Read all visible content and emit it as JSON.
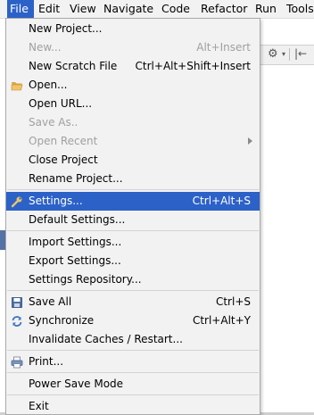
{
  "menubar": {
    "items": [
      {
        "label": "File"
      },
      {
        "label": "Edit"
      },
      {
        "label": "View"
      },
      {
        "label": "Navigate"
      },
      {
        "label": "Code"
      },
      {
        "label": "Refactor"
      },
      {
        "label": "Run"
      },
      {
        "label": "Tools"
      }
    ]
  },
  "file_menu": {
    "items": [
      {
        "label": "New Project...",
        "shortcut": ""
      },
      {
        "label": "New...",
        "shortcut": "Alt+Insert"
      },
      {
        "label": "New Scratch File",
        "shortcut": "Ctrl+Alt+Shift+Insert"
      },
      {
        "label": "Open...",
        "shortcut": "",
        "icon": "folder-icon"
      },
      {
        "label": "Open URL...",
        "shortcut": ""
      },
      {
        "label": "Save As..",
        "shortcut": ""
      },
      {
        "label": "Open Recent",
        "shortcut": ""
      },
      {
        "label": "Close Project",
        "shortcut": ""
      },
      {
        "label": "Rename Project...",
        "shortcut": ""
      },
      {
        "label": "Settings...",
        "shortcut": "Ctrl+Alt+S",
        "icon": "wrench-icon"
      },
      {
        "label": "Default Settings...",
        "shortcut": ""
      },
      {
        "label": "Import Settings...",
        "shortcut": ""
      },
      {
        "label": "Export Settings...",
        "shortcut": ""
      },
      {
        "label": "Settings Repository...",
        "shortcut": ""
      },
      {
        "label": "Save All",
        "shortcut": "Ctrl+S",
        "icon": "save-all-icon"
      },
      {
        "label": "Synchronize",
        "shortcut": "Ctrl+Alt+Y",
        "icon": "sync-icon"
      },
      {
        "label": "Invalidate Caches / Restart...",
        "shortcut": ""
      },
      {
        "label": "Print...",
        "shortcut": "",
        "icon": "printer-icon"
      },
      {
        "label": "Power Save Mode",
        "shortcut": ""
      },
      {
        "label": "Exit",
        "shortcut": ""
      }
    ],
    "selected": "Settings...",
    "disabled": [
      "New...",
      "Save As..",
      "Open Recent"
    ]
  },
  "colors": {
    "accent": "#2c61c7",
    "menu_bg": "#f2f2f2",
    "disabled_text": "#a0a0a0"
  }
}
